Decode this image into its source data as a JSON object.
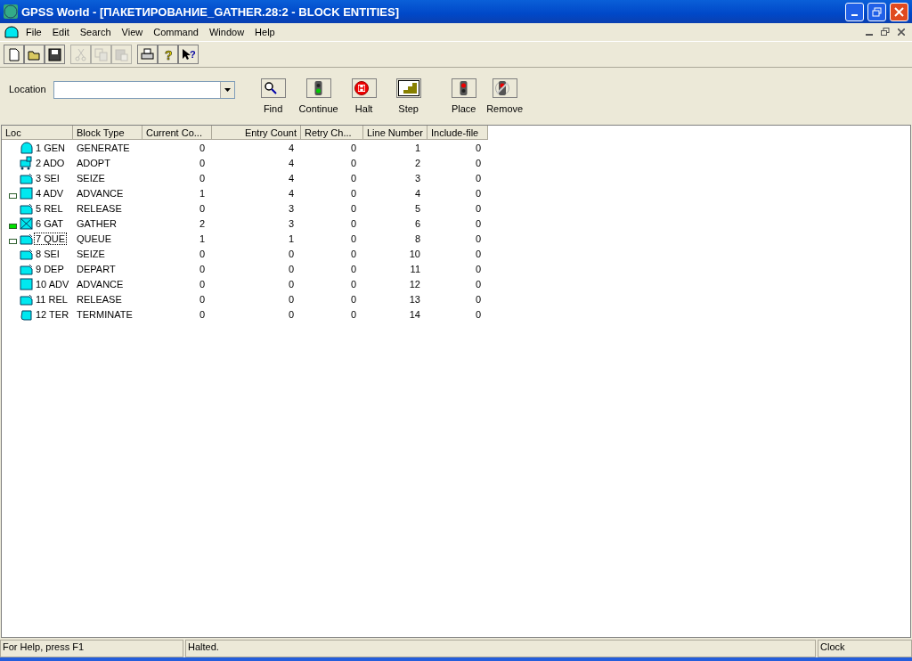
{
  "window": {
    "title": "GPSS World - [ПАКЕТИРОВАНИЕ_GATHER.28:2  -  BLOCK ENTITIES]"
  },
  "menu": [
    "File",
    "Edit",
    "Search",
    "View",
    "Command",
    "Window",
    "Help"
  ],
  "toolbar": [
    {
      "kind": "new",
      "disabled": false
    },
    {
      "kind": "open",
      "disabled": false
    },
    {
      "kind": "save",
      "disabled": false
    },
    {
      "kind": "cut",
      "disabled": true
    },
    {
      "kind": "copy",
      "disabled": true
    },
    {
      "kind": "paste",
      "disabled": true
    },
    {
      "kind": "print",
      "disabled": false
    },
    {
      "kind": "help",
      "disabled": false,
      "glyph": "?"
    },
    {
      "kind": "context-help",
      "disabled": false,
      "glyph": "?"
    }
  ],
  "location": {
    "label": "Location"
  },
  "actions": [
    {
      "kind": "find",
      "label": "Find"
    },
    {
      "kind": "continue",
      "label": "Continue"
    },
    {
      "kind": "halt",
      "label": "Halt"
    },
    {
      "kind": "step",
      "label": "Step"
    },
    {
      "kind": "place",
      "label": "Place"
    },
    {
      "kind": "remove",
      "label": "Remove"
    }
  ],
  "table": {
    "columns": [
      "Loc",
      "Block Type",
      "Current Co...",
      "Entry Count",
      "Retry Ch...",
      "Line Number",
      "Include-file"
    ],
    "rows": [
      {
        "kind": "generate",
        "has_marker": false,
        "marker_active": false,
        "selected": false,
        "cells": [
          "1 GEN",
          "GENERATE",
          "0",
          "4",
          "0",
          "1",
          "0"
        ]
      },
      {
        "kind": "adopt",
        "has_marker": false,
        "marker_active": false,
        "selected": false,
        "cells": [
          "2 ADO",
          "ADOPT",
          "0",
          "4",
          "0",
          "2",
          "0"
        ]
      },
      {
        "kind": "seize",
        "has_marker": false,
        "marker_active": false,
        "selected": false,
        "cells": [
          "3 SEI",
          "SEIZE",
          "0",
          "4",
          "0",
          "3",
          "0"
        ]
      },
      {
        "kind": "advance",
        "has_marker": true,
        "marker_active": false,
        "selected": false,
        "cells": [
          "4 ADV",
          "ADVANCE",
          "1",
          "4",
          "0",
          "4",
          "0"
        ]
      },
      {
        "kind": "release",
        "has_marker": false,
        "marker_active": false,
        "selected": false,
        "cells": [
          "5 REL",
          "RELEASE",
          "0",
          "3",
          "0",
          "5",
          "0"
        ]
      },
      {
        "kind": "gather",
        "has_marker": true,
        "marker_active": true,
        "selected": false,
        "cells": [
          "6 GAT",
          "GATHER",
          "2",
          "3",
          "0",
          "6",
          "0"
        ]
      },
      {
        "kind": "queue",
        "has_marker": true,
        "marker_active": false,
        "selected": true,
        "cells": [
          "7 QUE",
          "QUEUE",
          "1",
          "1",
          "0",
          "8",
          "0"
        ]
      },
      {
        "kind": "seize",
        "has_marker": false,
        "marker_active": false,
        "selected": false,
        "cells": [
          "8 SEI",
          "SEIZE",
          "0",
          "0",
          "0",
          "10",
          "0"
        ]
      },
      {
        "kind": "depart",
        "has_marker": false,
        "marker_active": false,
        "selected": false,
        "cells": [
          "9 DEP",
          "DEPART",
          "0",
          "0",
          "0",
          "11",
          "0"
        ]
      },
      {
        "kind": "advance",
        "has_marker": false,
        "marker_active": false,
        "selected": false,
        "cells": [
          "10 ADV",
          "ADVANCE",
          "0",
          "0",
          "0",
          "12",
          "0"
        ]
      },
      {
        "kind": "release",
        "has_marker": false,
        "marker_active": false,
        "selected": false,
        "cells": [
          "11 REL",
          "RELEASE",
          "0",
          "0",
          "0",
          "13",
          "0"
        ]
      },
      {
        "kind": "terminate",
        "has_marker": false,
        "marker_active": false,
        "selected": false,
        "cells": [
          "12 TER",
          "TERMINATE",
          "0",
          "0",
          "0",
          "14",
          "0"
        ]
      }
    ]
  },
  "status_bar": [
    "For Help, press F1",
    "Halted.",
    "Clock"
  ]
}
